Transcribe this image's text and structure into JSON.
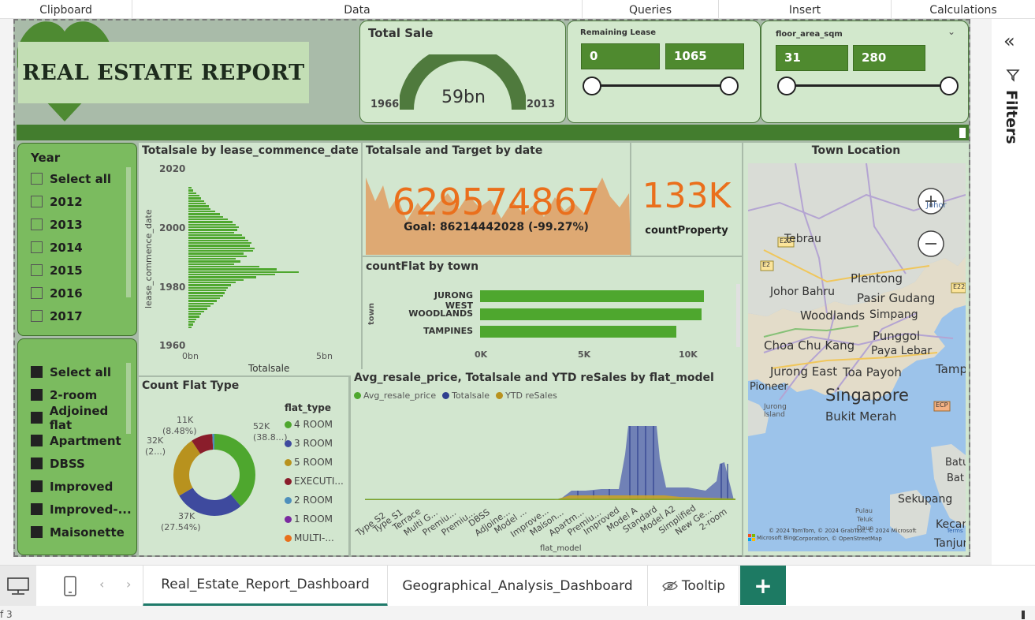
{
  "ribbon": [
    {
      "label": "Clipboard"
    },
    {
      "label": "Data"
    },
    {
      "label": "Queries"
    },
    {
      "label": "Insert"
    },
    {
      "label": "Calculations"
    }
  ],
  "header": {
    "report_title": "REAL ESTATE REPORT"
  },
  "total_sale": {
    "title": "Total Sale",
    "value": "59bn",
    "min": "1966",
    "max": "2013",
    "fraction": 1.0
  },
  "remaining_lease": {
    "title": "Remaining Lease",
    "min": "0",
    "max": "1065"
  },
  "floor_area": {
    "title": "floor_area_sqm",
    "min": "31",
    "max": "280"
  },
  "year_slicer": {
    "title": "Year",
    "items": [
      {
        "label": "Select all"
      },
      {
        "label": "2012"
      },
      {
        "label": "2013"
      },
      {
        "label": "2014"
      },
      {
        "label": "2015"
      },
      {
        "label": "2016"
      },
      {
        "label": "2017"
      }
    ]
  },
  "flat_model_slicer": {
    "items": [
      {
        "label": "Select all"
      },
      {
        "label": "2-room"
      },
      {
        "label": "Adjoined flat"
      },
      {
        "label": "Apartment"
      },
      {
        "label": "DBSS"
      },
      {
        "label": "Improved"
      },
      {
        "label": "Improved-..."
      },
      {
        "label": "Maisonette"
      }
    ]
  },
  "lease_chart": {
    "title": "Totalsale by lease_commence_date",
    "y_axis_label": "lease_commence_date",
    "x_axis_label": "Totalsale",
    "y_ticks": [
      "2020",
      "2000",
      "1980",
      "1960"
    ],
    "x_ticks": [
      "0bn",
      "5bn"
    ]
  },
  "target_kpi": {
    "title": "Totalsale and Target by date",
    "value": "629574867",
    "goal": "Goal: 86214442028 (-99.27%)"
  },
  "count_property": {
    "value": "133K",
    "label": "countProperty"
  },
  "town_chart": {
    "title": "countFlat by town",
    "axis_label": "town",
    "ticks": [
      "0K",
      "5K",
      "10K"
    ]
  },
  "flat_type_chart": {
    "title": "Count Flat Type",
    "legend_title": "flat_type",
    "labels": {
      "s1": "52K",
      "s1b": "(38.8...)",
      "s2": "37K",
      "s2b": "(27.54%)",
      "s3": "32K",
      "s3b": "(2...)",
      "s4": "11K",
      "s4b": "(8.48%)"
    }
  },
  "model_chart": {
    "title": "Avg_resale_price, Totalsale and YTD reSales by flat_model",
    "x_axis_label": "flat_model",
    "legend": [
      {
        "label": "Avg_resale_price",
        "color": "#4ea72e"
      },
      {
        "label": "Totalsale",
        "color": "#2f3f8f"
      },
      {
        "label": "YTD reSales",
        "color": "#b8921e"
      }
    ]
  },
  "map": {
    "title": "Town Location",
    "places": {
      "johor": "Johor",
      "tebrau": "Tebrau",
      "plentong": "Plentong",
      "johor_bahru": "Johor Bahru",
      "pasir_gudang": "Pasir Gudang",
      "woodlands": "Woodlands",
      "simpang": "Simpang",
      "punggol": "Punggol",
      "choa_chu_kang": "Choa Chu Kang",
      "paya_lebar": "Paya Lebar",
      "jurong_east": "Jurong East",
      "toa_payoh": "Toa Payoh",
      "tampir": "Tampir",
      "pioneer": "Pioneer",
      "singapore": "Singapore",
      "bukit_merah": "Bukit Merah",
      "jurong_island": "Jurong Island",
      "batuam": "Batuam",
      "bat": "Bat",
      "sekupang": "Sekupang",
      "kecamat": "Kecamat",
      "tanjung": "Tanjung",
      "pulau": "Pulau",
      "teluk": "Teluk",
      "daun": "Daun"
    },
    "road_labels": [
      "E22",
      "E2",
      "E22",
      "ECP"
    ],
    "attribution": "© 2024 TomTom, © 2024 GrabTaxi, © 2024 Microsoft",
    "attribution2": "Corporation, © OpenStreetMap",
    "terms": "Terms",
    "ms_logo_text": "Microsoft Bing"
  },
  "filters_pane": {
    "label": "Filters"
  },
  "tabs": [
    {
      "label": "Real_Estate_Report_Dashboard",
      "active": true
    },
    {
      "label": "Geographical_Analysis_Dashboard",
      "active": false
    },
    {
      "label": "Tooltip",
      "active": false
    }
  ],
  "status": {
    "page_text": "f 3"
  }
}
